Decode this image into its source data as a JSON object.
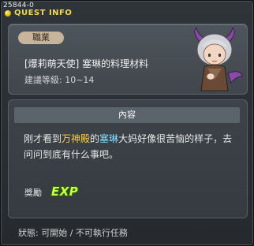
{
  "quest_id": "25844-0",
  "window_title": "QUEST INFO",
  "job_badge": "職業",
  "quest_name": "[爆莉萌天使] 塞琳的料理材料",
  "level_text": "建議等級: 10~14",
  "section_title": "內容",
  "content": {
    "part1": "刚才看到",
    "name1": "万神殿",
    "part2": "的",
    "name2": "塞琳",
    "part3": "大妈好像很苦恼的样子，去问问到底有什么事吧。"
  },
  "reward_label": "獎勵",
  "reward_exp": "EXP",
  "status_text": "狀態: 可開始 / 不可執行任務",
  "colors": {
    "title": "#f2d75b",
    "highlight_location": "#ffd23c",
    "highlight_npc": "#7fe0ff",
    "exp": "#c9ff4d"
  }
}
